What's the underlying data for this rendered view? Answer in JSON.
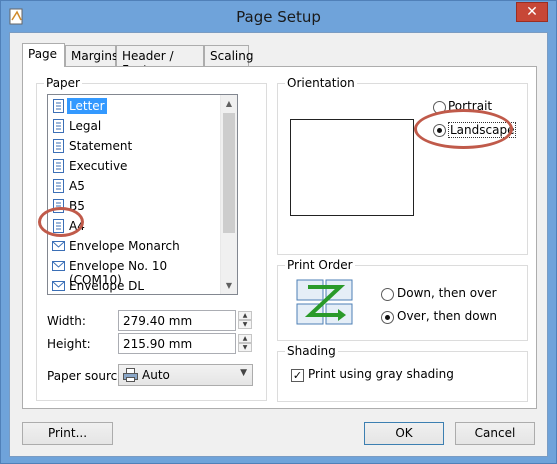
{
  "window": {
    "title": "Page Setup",
    "close_glyph": "✕"
  },
  "tabs": [
    {
      "label": "Page",
      "active": true
    },
    {
      "label": "Margins",
      "active": false
    },
    {
      "label": "Header / Footer",
      "active": false
    },
    {
      "label": "Scaling",
      "active": false
    }
  ],
  "paper": {
    "group_label": "Paper",
    "list": [
      {
        "label": "Letter",
        "icon": "page-icon",
        "selected": true
      },
      {
        "label": "Legal",
        "icon": "page-icon"
      },
      {
        "label": "Statement",
        "icon": "page-icon"
      },
      {
        "label": "Executive",
        "icon": "page-icon"
      },
      {
        "label": "A5",
        "icon": "page-icon"
      },
      {
        "label": "B5",
        "icon": "page-icon"
      },
      {
        "label": "A4",
        "icon": "page-icon"
      },
      {
        "label": "Envelope Monarch",
        "icon": "envelope-icon"
      },
      {
        "label": "Envelope No. 10 (COM10)",
        "icon": "envelope-icon"
      },
      {
        "label": "Envelope DL",
        "icon": "envelope-icon"
      }
    ],
    "width_label": "Width:",
    "width_value": "279.40 mm",
    "height_label": "Height:",
    "height_value": "215.90 mm",
    "source_label": "Paper source:",
    "source_value": "Auto"
  },
  "orientation": {
    "group_label": "Orientation",
    "portrait_label": "Portrait",
    "landscape_label": "Landscape",
    "selected": "Landscape"
  },
  "print_order": {
    "group_label": "Print Order",
    "down_then_over": "Down, then over",
    "over_then_down": "Over, then down",
    "selected": "Over, then down"
  },
  "shading": {
    "group_label": "Shading",
    "checkbox_label": "Print using gray shading",
    "checked": true
  },
  "buttons": {
    "print": "Print...",
    "ok": "OK",
    "cancel": "Cancel"
  },
  "colors": {
    "titlebar": "#6fa3da",
    "selection": "#3399ff",
    "highlight_circle": "#c05a4a",
    "close": "#c74737"
  }
}
